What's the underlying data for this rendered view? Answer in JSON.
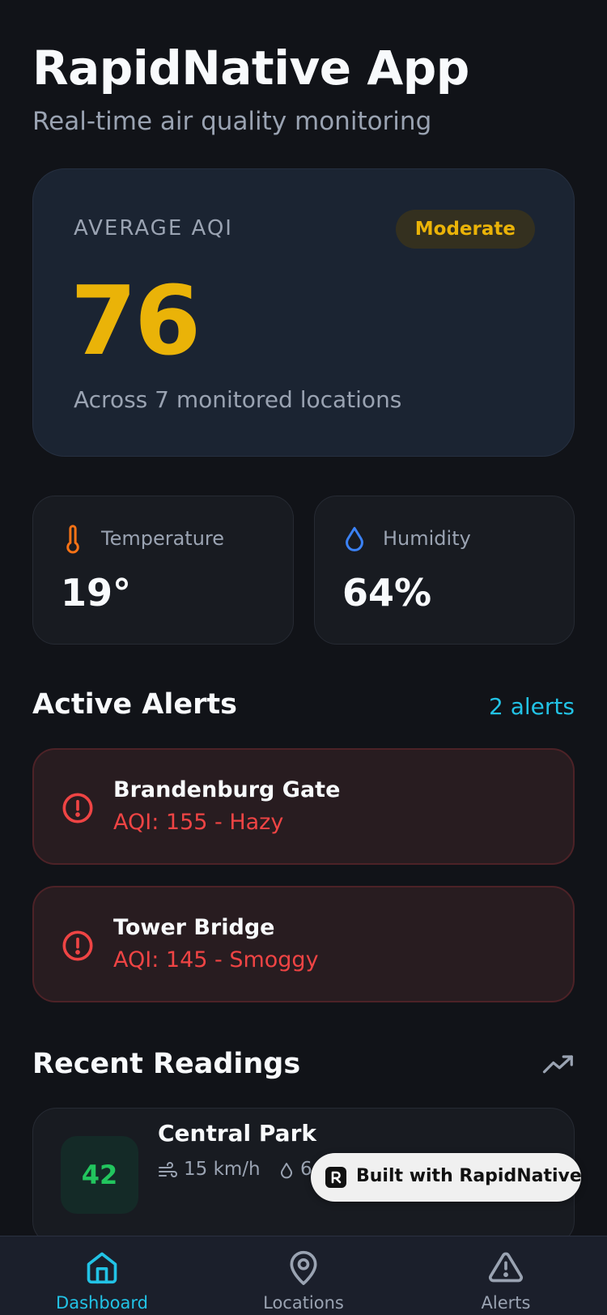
{
  "header": {
    "title": "RapidNative App",
    "subtitle": "Real-time air quality monitoring"
  },
  "aqi": {
    "label": "AVERAGE AQI",
    "badge": "Moderate",
    "value": "76",
    "caption": "Across 7 monitored locations",
    "accent_color": "#eab308"
  },
  "stats": {
    "temperature": {
      "label": "Temperature",
      "value": "19°",
      "icon": "thermometer-icon"
    },
    "humidity": {
      "label": "Humidity",
      "value": "64%",
      "icon": "droplet-icon"
    }
  },
  "alerts": {
    "title": "Active Alerts",
    "count_label": "2 alerts",
    "items": [
      {
        "name": "Brandenburg Gate",
        "detail": "AQI: 155 - Hazy"
      },
      {
        "name": "Tower Bridge",
        "detail": "AQI: 145 - Smoggy"
      }
    ],
    "color": "#ef4444"
  },
  "readings": {
    "title": "Recent Readings",
    "items": [
      {
        "aqi": "42",
        "name": "Central Park",
        "wind": "15 km/h",
        "humidity": "6"
      }
    ]
  },
  "built_with": {
    "label": "Built with RapidNative"
  },
  "nav": {
    "items": [
      {
        "label": "Dashboard",
        "icon": "home-icon",
        "active": true
      },
      {
        "label": "Locations",
        "icon": "map-pin-icon",
        "active": false
      },
      {
        "label": "Alerts",
        "icon": "alert-triangle-icon",
        "active": false
      }
    ],
    "active_color": "#22c3e6"
  }
}
